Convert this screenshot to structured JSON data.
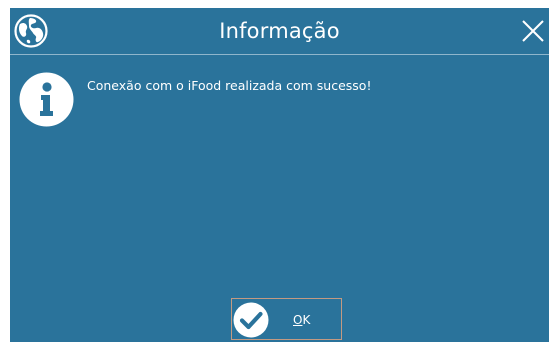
{
  "window": {
    "title": "Informação",
    "close_icon": "close-icon",
    "app_icon": "globe-icon"
  },
  "content": {
    "icon": "info-icon",
    "message": "Conexão com o iFood realizada com sucesso!"
  },
  "buttons": {
    "ok": {
      "icon": "checkmark-icon",
      "mnemonic": "O",
      "rest": "K"
    }
  },
  "colors": {
    "background": "#2a739b",
    "text": "#ffffff",
    "button_border": "#c39a82"
  }
}
